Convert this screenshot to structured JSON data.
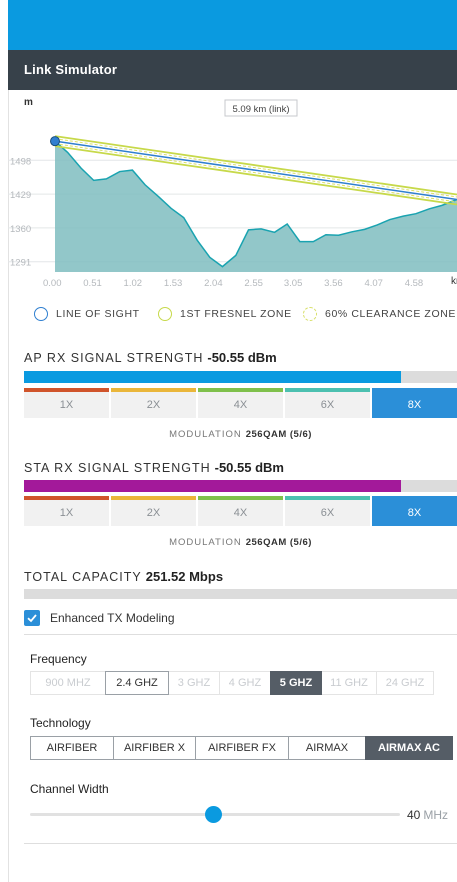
{
  "panel": {
    "title": "Link Simulator"
  },
  "chart_data": {
    "type": "area",
    "y_axis_unit_label": "m",
    "x_axis_unit_label": "km",
    "link_label": "5.09 km (link)",
    "x_ticks": [
      "0.00",
      "0.51",
      "1.02",
      "1.53",
      "2.04",
      "2.55",
      "3.05",
      "3.56",
      "4.07",
      "4.58"
    ],
    "y_ticks": [
      "1498",
      "1429",
      "1360",
      "1291"
    ],
    "ylim": [
      1270,
      1570
    ],
    "xlim": [
      0,
      5.09
    ],
    "terrain": {
      "x": [
        0,
        0.16,
        0.33,
        0.49,
        0.65,
        0.82,
        0.98,
        1.14,
        1.31,
        1.47,
        1.63,
        1.8,
        1.96,
        2.12,
        2.29,
        2.45,
        2.61,
        2.78,
        2.94,
        3.1,
        3.27,
        3.43,
        3.59,
        3.76,
        3.92,
        4.08,
        4.24,
        4.41,
        4.57,
        4.74,
        4.9,
        5.09
      ],
      "y": [
        1537,
        1514,
        1482,
        1457,
        1460,
        1475,
        1478,
        1448,
        1424,
        1400,
        1381,
        1335,
        1300,
        1281,
        1304,
        1356,
        1358,
        1351,
        1368,
        1332,
        1332,
        1346,
        1345,
        1352,
        1357,
        1366,
        1377,
        1384,
        1389,
        1399,
        1406,
        1418
      ]
    },
    "line_of_sight": {
      "start": [
        0,
        1537
      ],
      "end": [
        5.09,
        1418
      ]
    },
    "legend": [
      {
        "label": "LINE OF SIGHT",
        "color": "#2f7fd0",
        "style": "solid"
      },
      {
        "label": "1ST FRESNEL ZONE",
        "color": "#c7d94a",
        "style": "solid"
      },
      {
        "label": "60% CLEARANCE ZONE",
        "color": "#d8e06a",
        "style": "dashed"
      }
    ],
    "grid": true
  },
  "ap_rx": {
    "label": "AP RX SIGNAL STRENGTH",
    "value": "-50.55 dBm",
    "level": 0.87,
    "bar_color": "#0a9ae0",
    "modulation_label": "MODULATION",
    "modulation_value": "256QAM (5/6)"
  },
  "sta_rx": {
    "label": "STA RX SIGNAL STRENGTH",
    "value": "-50.55 dBm",
    "level": 0.87,
    "bar_color": "#a3199a",
    "modulation_label": "MODULATION",
    "modulation_value": "256QAM (5/6)"
  },
  "modulation_levels": [
    "1X",
    "2X",
    "4X",
    "6X",
    "8X"
  ],
  "modulation_active": "8X",
  "modulation_colors": [
    "#d0542b",
    "#eab63a",
    "#7fc04b",
    "#4cc0b0",
    "#2b8fd8"
  ],
  "capacity": {
    "label": "TOTAL CAPACITY",
    "value": "251.52 Mbps"
  },
  "enhanced_tx": {
    "label": "Enhanced TX Modeling",
    "checked": true
  },
  "frequency": {
    "label": "Frequency",
    "options": [
      "900 MHZ",
      "2.4 GHZ",
      "3 GHZ",
      "4 GHZ",
      "5 GHZ",
      "11 GHZ",
      "24 GHZ"
    ],
    "enabled": [
      "2.4 GHZ",
      "5 GHZ"
    ],
    "selected": "5 GHZ"
  },
  "technology": {
    "label": "Technology",
    "options": [
      "AIRFIBER",
      "AIRFIBER X",
      "AIRFIBER FX",
      "AIRMAX",
      "AIRMAX AC"
    ],
    "selected": "AIRMAX AC"
  },
  "channel_width": {
    "label": "Channel Width",
    "value": "40",
    "unit": "MHz",
    "position": 0.49
  },
  "colors": {
    "accent": "#0a9ae0",
    "header_bg": "#37414a",
    "terrain": "#7fbdc0",
    "terrain_line": "#1aa3b0"
  }
}
